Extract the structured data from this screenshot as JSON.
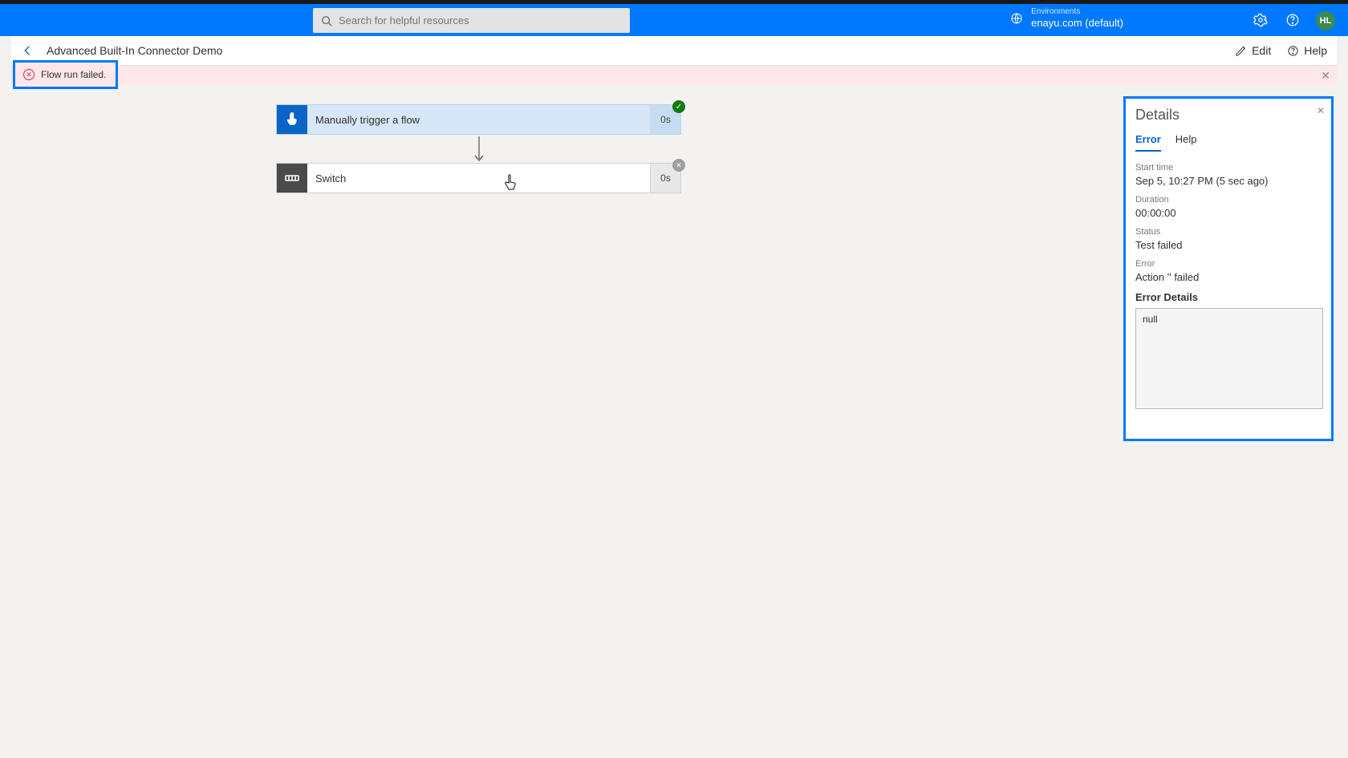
{
  "topbar": {
    "search_placeholder": "Search for helpful resources",
    "env_label": "Environments",
    "env_value": "enayu.com (default)",
    "avatar": "HL"
  },
  "subheader": {
    "title": "Advanced Built-In Connector Demo",
    "edit_label": "Edit",
    "help_label": "Help"
  },
  "banner": {
    "message": "Flow run failed."
  },
  "flow": {
    "trigger": {
      "label": "Manually trigger a flow",
      "duration": "0s",
      "status": "ok"
    },
    "switch": {
      "label": "Switch",
      "duration": "0s",
      "status": "fail"
    }
  },
  "details": {
    "title": "Details",
    "tabs": {
      "error": "Error",
      "help": "Help"
    },
    "fields": {
      "start_label": "Start time",
      "start_value": "Sep 5, 10:27 PM (5 sec ago)",
      "duration_label": "Duration",
      "duration_value": "00:00:00",
      "status_label": "Status",
      "status_value": "Test failed",
      "error_label": "Error",
      "error_value": "Action '' failed"
    },
    "error_details_label": "Error Details",
    "error_details_value": "null"
  }
}
